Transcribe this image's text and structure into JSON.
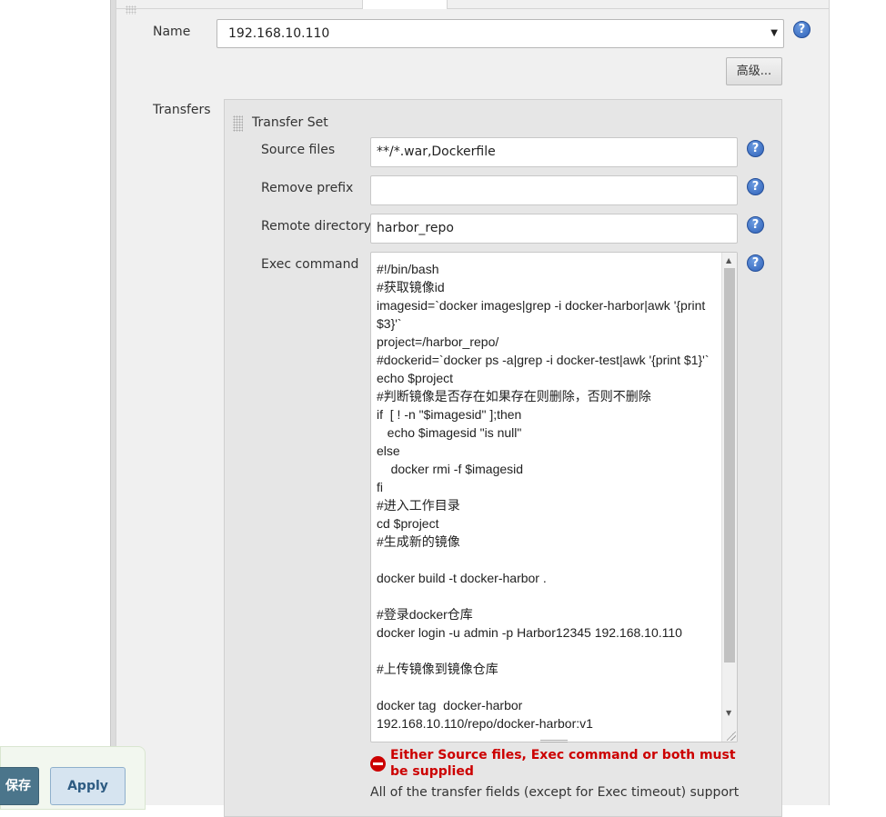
{
  "server": {
    "label": "Name",
    "selected": "192.168.10.110",
    "advanced_button": "高级..."
  },
  "transfers": {
    "label": "Transfers",
    "set_title": "Transfer Set",
    "source_files": {
      "label": "Source files",
      "value": "**/*.war,Dockerfile"
    },
    "remove_prefix": {
      "label": "Remove prefix",
      "value": ""
    },
    "remote_directory": {
      "label": "Remote directory",
      "value": "harbor_repo"
    },
    "exec_command": {
      "label": "Exec command",
      "value": "#!/bin/bash\n#获取镜像id\nimagesid=`docker images|grep -i docker-harbor|awk '{print $3}'`\nproject=/harbor_repo/\n#dockerid=`docker ps -a|grep -i docker-test|awk '{print $1}'`\necho $project\n#判断镜像是否存在如果存在则删除，否则不删除\nif  [ ! -n \"$imagesid\" ];then\n   echo $imagesid \"is null\"\nelse\n    docker rmi -f $imagesid\nfi\n#进入工作目录\ncd $project\n#生成新的镜像\n\ndocker build -t docker-harbor .\n\n#登录docker仓库\ndocker login -u admin -p Harbor12345 192.168.10.110\n\n#上传镜像到镜像仓库\n\ndocker tag  docker-harbor\n192.168.10.110/repo/docker-harbor:v1"
    },
    "error": "Either Source files, Exec command or both must be supplied",
    "info": "All of the transfer fields (except for Exec timeout) support"
  },
  "footer": {
    "save_label": "保存",
    "apply_label": "Apply"
  },
  "help_glyph": "?",
  "icons": [
    "help-icon",
    "error-icon",
    "drag-handle-icon",
    "chevron-down-icon"
  ],
  "colors": {
    "error": "#cc0000",
    "help": "#2f61b8",
    "save_button": "#4b758b",
    "apply_button": "#d6e4f0"
  }
}
